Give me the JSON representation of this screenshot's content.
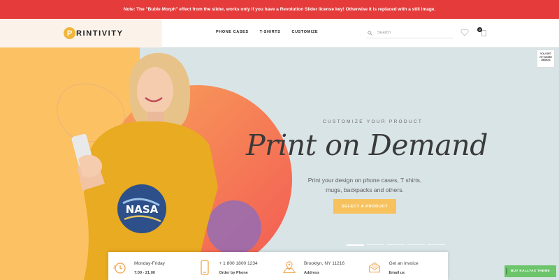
{
  "notice": {
    "text": "Note: The \"Buble Morph\" effect from the slider, works only if you have a Revolution Slider license key! Otherwise it is replaced with a still image."
  },
  "header": {
    "logo_letter": "P",
    "logo_rest": "RINTIVITY",
    "nav": [
      "PHONE CASES",
      "T-SHIRTS",
      "CUSTOMIZE"
    ],
    "search_placeholder": "Search",
    "cart_count": "0"
  },
  "hero": {
    "tagline": "CUSTOMIZE YOUR PRODUCT",
    "headline": "Print on Demand",
    "subtitle_line1": "Print your design on phone cases, T shirts,",
    "subtitle_line2": "mugs, backpacks and others.",
    "cta": "SELECT A PRODUCT",
    "shirt_print": "NASA",
    "slide_count": 5,
    "active_slide": 1
  },
  "side_promo": [
    "YOU GET",
    "70+ MORE",
    "DEMOS"
  ],
  "info": [
    {
      "icon": "clock-icon",
      "line1": "Monday-Friday",
      "line2": "7:00 - 21:00"
    },
    {
      "icon": "phone-icon",
      "line1": "+ 1 800 1800 1234",
      "line2": "Order by Phone"
    },
    {
      "icon": "map-icon",
      "line1": "Brooklyn, NY 11216",
      "line2": "Address"
    },
    {
      "icon": "envelope-icon",
      "line1": "Get an invoice",
      "line2": "Email us"
    }
  ],
  "buy_button": "BUY KALLYAS THEME",
  "colors": {
    "notice_red": "#e53b3b",
    "accent_yellow": "#f7c25e",
    "hero_blue": "#d9e4e7",
    "blob_orange": "#f46a53",
    "blob_purple": "#9b6dae",
    "buy_green": "#6cc56b",
    "icon_orange": "#f1a449"
  }
}
